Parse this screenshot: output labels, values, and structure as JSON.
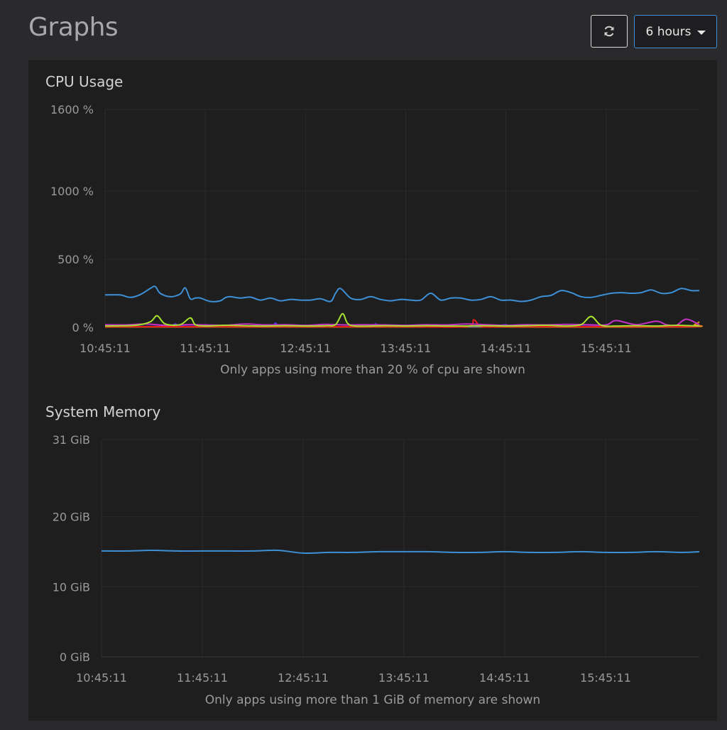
{
  "header": {
    "title": "Graphs",
    "refresh_icon": "refresh-icon",
    "range_label": "6 hours"
  },
  "colors": {
    "background": "#2a2a2d",
    "panel": "#1e1e1f",
    "accent": "#3d8fd6"
  },
  "chart_data": [
    {
      "type": "line",
      "title": "CPU Usage",
      "note": "Only apps using more than 20 % of cpu are shown",
      "unit": "%",
      "y_ticks": [
        0,
        500,
        1000,
        1600
      ],
      "y_tick_labels": [
        "0 %",
        "500 %",
        "1000 %",
        "1600 %"
      ],
      "ylim": [
        0,
        1600
      ],
      "x_tick_labels": [
        "10:45:11",
        "11:45:11",
        "12:45:11",
        "13:45:11",
        "14:45:11",
        "15:45:11"
      ],
      "x_ticks_hours": [
        0,
        1,
        2,
        3,
        4,
        5
      ],
      "xlim_hours": [
        0,
        5.93
      ],
      "grid": true,
      "legend": "none",
      "series": [
        {
          "color": "#3d8fd6",
          "x": [
            0,
            0.15,
            0.25,
            0.35,
            0.45,
            0.5,
            0.55,
            0.65,
            0.75,
            0.8,
            0.85,
            0.9,
            0.95,
            1.05,
            1.15,
            1.2,
            1.25,
            1.35,
            1.45,
            1.55,
            1.65,
            1.75,
            1.85,
            1.95,
            2.05,
            2.15,
            2.25,
            2.3,
            2.35,
            2.45,
            2.55,
            2.65,
            2.75,
            2.85,
            2.95,
            3.05,
            3.15,
            3.25,
            3.35,
            3.45,
            3.55,
            3.65,
            3.75,
            3.85,
            3.95,
            4.05,
            4.15,
            4.25,
            4.35,
            4.45,
            4.55,
            4.65,
            4.75,
            4.85,
            4.95,
            5.05,
            5.15,
            5.25,
            5.35,
            5.45,
            5.55,
            5.65,
            5.75,
            5.85,
            5.93
          ],
          "values": [
            238,
            238,
            220,
            240,
            285,
            300,
            250,
            225,
            245,
            290,
            210,
            215,
            215,
            190,
            195,
            218,
            225,
            215,
            222,
            200,
            215,
            195,
            205,
            200,
            200,
            210,
            190,
            250,
            285,
            215,
            205,
            225,
            205,
            195,
            205,
            200,
            200,
            250,
            200,
            215,
            215,
            200,
            205,
            225,
            200,
            200,
            190,
            200,
            225,
            235,
            270,
            255,
            225,
            220,
            235,
            250,
            255,
            250,
            255,
            275,
            250,
            255,
            285,
            270,
            270
          ]
        },
        {
          "color": "#a6e22e",
          "x": [
            0,
            0.3,
            0.45,
            0.52,
            0.6,
            0.75,
            0.85,
            0.9,
            1.0,
            1.2,
            1.4,
            1.6,
            1.8,
            2.0,
            2.2,
            2.3,
            2.37,
            2.42,
            2.5,
            2.8,
            3.0,
            3.2,
            3.4,
            3.6,
            3.8,
            4.0,
            4.2,
            4.4,
            4.6,
            4.75,
            4.85,
            4.95,
            5.1,
            5.3,
            5.5,
            5.7,
            5.93
          ],
          "values": [
            10,
            15,
            40,
            85,
            25,
            20,
            70,
            20,
            10,
            15,
            12,
            10,
            12,
            10,
            12,
            20,
            100,
            30,
            10,
            12,
            10,
            12,
            10,
            10,
            12,
            10,
            12,
            15,
            10,
            20,
            80,
            15,
            10,
            12,
            10,
            15,
            10
          ]
        },
        {
          "color": "#c531c5",
          "x": [
            0,
            0.2,
            0.4,
            0.6,
            0.8,
            1.0,
            1.2,
            1.4,
            1.6,
            1.8,
            2.0,
            2.2,
            2.4,
            2.6,
            2.8,
            3.0,
            3.2,
            3.4,
            3.6,
            3.8,
            4.0,
            4.2,
            4.4,
            4.6,
            4.8,
            5.0,
            5.1,
            5.3,
            5.5,
            5.6,
            5.7,
            5.8,
            5.93
          ],
          "values": [
            20,
            18,
            25,
            15,
            20,
            18,
            15,
            25,
            18,
            20,
            15,
            22,
            18,
            20,
            18,
            15,
            20,
            18,
            25,
            20,
            15,
            20,
            18,
            22,
            20,
            18,
            50,
            20,
            45,
            20,
            15,
            60,
            20
          ]
        },
        {
          "color": "#e81b1b",
          "x": [
            0,
            1.0,
            2.0,
            3.0,
            3.6,
            3.68,
            3.76,
            4.0,
            5.0,
            5.93
          ],
          "values": [
            5,
            5,
            5,
            5,
            5,
            55,
            5,
            5,
            5,
            5
          ]
        },
        {
          "color": "#4c3fe0",
          "x": [
            0,
            0.6,
            0.7,
            0.8,
            1.6,
            1.7,
            1.8,
            2.6,
            2.7,
            2.8,
            3.9,
            4.0,
            4.1,
            5.93
          ],
          "values": [
            8,
            8,
            25,
            8,
            8,
            30,
            8,
            8,
            25,
            8,
            8,
            20,
            8,
            8
          ]
        },
        {
          "color": "#e08a1b",
          "x": [
            0,
            2.0,
            4.0,
            5.8,
            5.88,
            5.93
          ],
          "values": [
            3,
            3,
            3,
            3,
            20,
            40
          ]
        }
      ]
    },
    {
      "type": "line",
      "title": "System Memory",
      "note": "Only apps using more than 1 GiB of memory are shown",
      "unit": "GiB",
      "y_ticks": [
        0,
        10,
        20,
        31
      ],
      "y_tick_labels": [
        "0 GiB",
        "10 GiB",
        "20 GiB",
        "31 GiB"
      ],
      "ylim": [
        0,
        31
      ],
      "x_tick_labels": [
        "10:45:11",
        "11:45:11",
        "12:45:11",
        "13:45:11",
        "14:45:11",
        "15:45:11"
      ],
      "x_ticks_hours": [
        0,
        1,
        2,
        3,
        4,
        5
      ],
      "xlim_hours": [
        0,
        5.93
      ],
      "grid": true,
      "legend": "none",
      "series": [
        {
          "color": "#3d8fd6",
          "x": [
            0,
            0.25,
            0.5,
            0.75,
            1.0,
            1.25,
            1.5,
            1.75,
            2.0,
            2.25,
            2.5,
            2.75,
            3.0,
            3.25,
            3.5,
            3.75,
            4.0,
            4.25,
            4.5,
            4.75,
            5.0,
            5.25,
            5.5,
            5.75,
            5.93
          ],
          "values": [
            15.1,
            15.1,
            15.2,
            15.1,
            15.1,
            15.1,
            15.1,
            15.2,
            14.8,
            14.9,
            14.9,
            15.0,
            15.0,
            15.0,
            14.9,
            14.9,
            15.0,
            14.9,
            14.9,
            15.0,
            14.9,
            14.9,
            15.0,
            14.9,
            15.0
          ]
        }
      ]
    }
  ]
}
